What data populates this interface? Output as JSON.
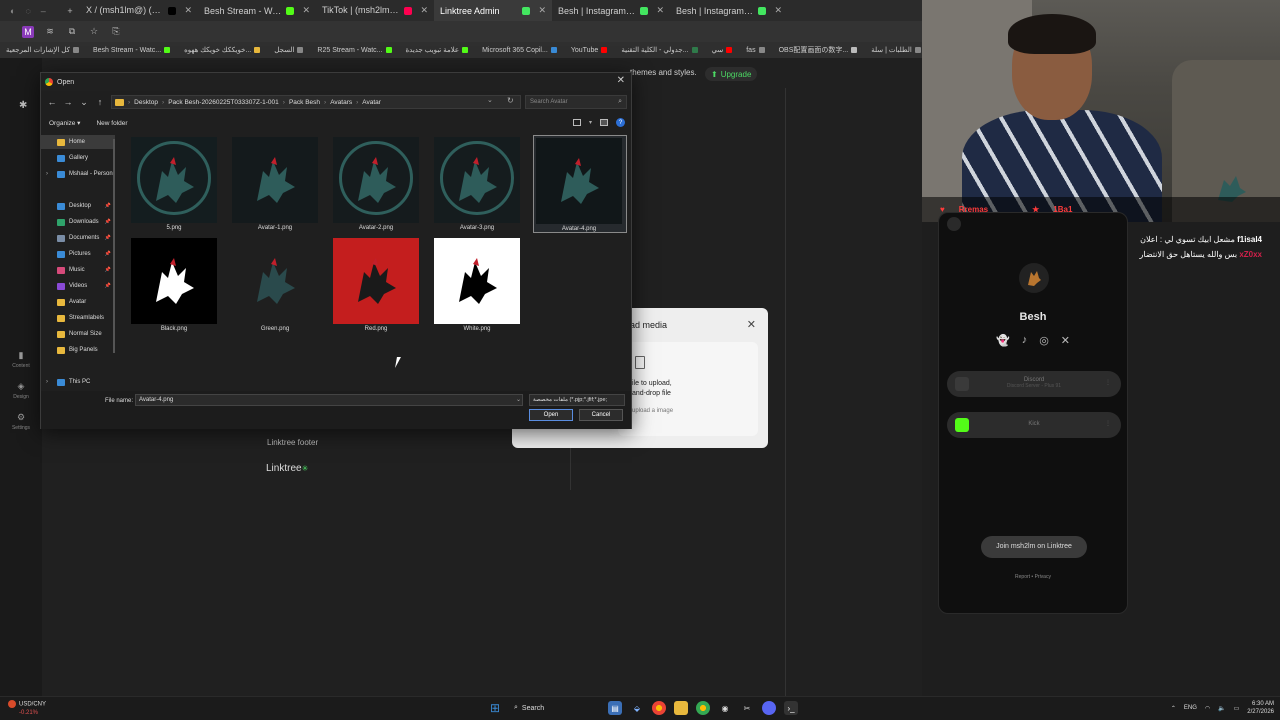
{
  "browser": {
    "tabs": [
      {
        "label": "X / (msh1lm@) مشعل (2)",
        "color": "#000000"
      },
      {
        "label": "Besh Stream - Watch Live on K",
        "color": "#53fc18"
      },
      {
        "label": "TikTok | (msh2lm@) مشعل",
        "color": "#ff0050"
      },
      {
        "label": "Linktree Admin",
        "color": "#43e660",
        "active": true
      },
      {
        "label": "Besh | Instagram, TikTok | Link",
        "color": "#43e660"
      },
      {
        "label": "Besh | Instagram, TikTok | Link",
        "color": "#43e660"
      }
    ],
    "bookmarks": [
      {
        "label": "كل الإشارات المرجعية"
      },
      {
        "label": "Besh Stream - Watc..."
      },
      {
        "label": "خويككك خويكك ههوه..."
      },
      {
        "label": "السجل"
      },
      {
        "label": "R25 Stream - Watc..."
      },
      {
        "label": "علامة تبويب جديدة"
      },
      {
        "label": "Microsoft 365 Copil..."
      },
      {
        "label": "YouTube"
      },
      {
        "label": "جدولي - الكلية التقنية..."
      },
      {
        "label": "سي"
      },
      {
        "label": "fas"
      },
      {
        "label": "OBS配置画面の数字..."
      },
      {
        "label": "الطلبات | سلة"
      },
      {
        "label": "Matz Sels I"
      }
    ]
  },
  "page": {
    "top_note": "themes and styles.",
    "upgrade_label": "Upgrade",
    "left_nav": [
      {
        "label": "Content"
      },
      {
        "label": "Design"
      },
      {
        "label": "Settings"
      }
    ],
    "footer_label": "Linktree footer",
    "linktree_logo": "Linktree"
  },
  "upload_modal": {
    "title": "ad media",
    "line1": "ile to upload,",
    "line2": "and-drop file",
    "line3": "upload a image"
  },
  "dialog": {
    "title": "Open",
    "path": [
      "Desktop",
      "Pack Besh-20260225T033307Z-1-001",
      "Pack Besh",
      "Avatars",
      "Avatar"
    ],
    "search_placeholder": "Search Avatar",
    "organize_label": "Organize",
    "new_folder_label": "New folder",
    "sidebar": [
      {
        "label": "Home",
        "icon": "home-icon",
        "color": "#e8b83d",
        "selected": true
      },
      {
        "label": "Gallery",
        "icon": "gallery-icon",
        "color": "#3a8bd6"
      },
      {
        "label": "Mshaal - Person",
        "icon": "cloud-icon",
        "color": "#3a8bd6",
        "expand": true
      },
      {
        "label": "Desktop",
        "icon": "desktop-icon",
        "color": "#3a8bd6",
        "pinned": true
      },
      {
        "label": "Downloads",
        "icon": "download-icon",
        "color": "#2fa36b",
        "pinned": true
      },
      {
        "label": "Documents",
        "icon": "documents-icon",
        "color": "#7a8da6",
        "pinned": true
      },
      {
        "label": "Pictures",
        "icon": "pictures-icon",
        "color": "#3a8bd6",
        "pinned": true
      },
      {
        "label": "Music",
        "icon": "music-icon",
        "color": "#d64a7a",
        "pinned": true
      },
      {
        "label": "Videos",
        "icon": "videos-icon",
        "color": "#8a4ad6",
        "pinned": true
      },
      {
        "label": "Avatar",
        "icon": "folder-icon",
        "color": "#e8b83d"
      },
      {
        "label": "Streamlabels",
        "icon": "folder-icon",
        "color": "#e8b83d"
      },
      {
        "label": "Normal Size",
        "icon": "folder-icon",
        "color": "#e8b83d"
      },
      {
        "label": "Big Panels",
        "icon": "folder-icon",
        "color": "#e8b83d"
      },
      {
        "label": "This PC",
        "icon": "pc-icon",
        "color": "#3a8bd6",
        "expand": true
      }
    ],
    "files": [
      {
        "name": "5.png",
        "bg": "#141d1f",
        "wolf": "#2e5c5a",
        "ring": true
      },
      {
        "name": "Avatar-1.png",
        "bg": "#141a1c",
        "wolf": "#2e5c5a",
        "ring": false
      },
      {
        "name": "Avatar-2.png",
        "bg": "#151b1d",
        "wolf": "#2e5c5a",
        "ring": true
      },
      {
        "name": "Avatar-3.png",
        "bg": "#151c1e",
        "wolf": "#2e5c5a",
        "ring": true
      },
      {
        "name": "Avatar-4.png",
        "bg": "#111719",
        "wolf": "#2e5c5a",
        "ring": false,
        "selected": true
      },
      {
        "name": "Black.png",
        "bg": "#000000",
        "wolf": "#ffffff",
        "ring": false
      },
      {
        "name": "Green.png",
        "bg": "#1f1f1f",
        "wolf": "#2a4a4c",
        "ring": false
      },
      {
        "name": "Red.png",
        "bg": "#c41e1e",
        "wolf": "#1a1a1a",
        "ring": false
      },
      {
        "name": "White.png",
        "bg": "#ffffff",
        "wolf": "#000000",
        "ring": false
      }
    ],
    "file_name_label": "File name:",
    "file_name_value": "Avatar-4.png",
    "file_type_value": "ملفات مخصصة (*.pjp;*.jfif;*.jpe;",
    "open_label": "Open",
    "cancel_label": "Cancel"
  },
  "webcam": {
    "overlay_1": "Rremas",
    "overlay_2": "1Ba1"
  },
  "phone": {
    "name": "Besh",
    "buttons": [
      {
        "label": "Discord",
        "sub": "Discord Server - Plus 91",
        "icon_color": "#3a3a3a"
      },
      {
        "label": "Kick",
        "sub": "",
        "icon_color": "#53fc18"
      }
    ],
    "join_label": "Join msh2lm on Linktree",
    "legal": "Report • Privacy"
  },
  "chat": [
    {
      "user": "f1isal4",
      "text": "مشعل ابيك تسوي لي : اعلان"
    },
    {
      "user": "xZ0xx",
      "text": "بس والله يستاهل حق الانتضار"
    }
  ],
  "taskbar": {
    "ticker_name": "USD/CNY",
    "ticker_change": "-0.21%",
    "search_label": "Search",
    "lang": "ENG",
    "time": "6:30 AM",
    "date": "2/27/2026"
  }
}
